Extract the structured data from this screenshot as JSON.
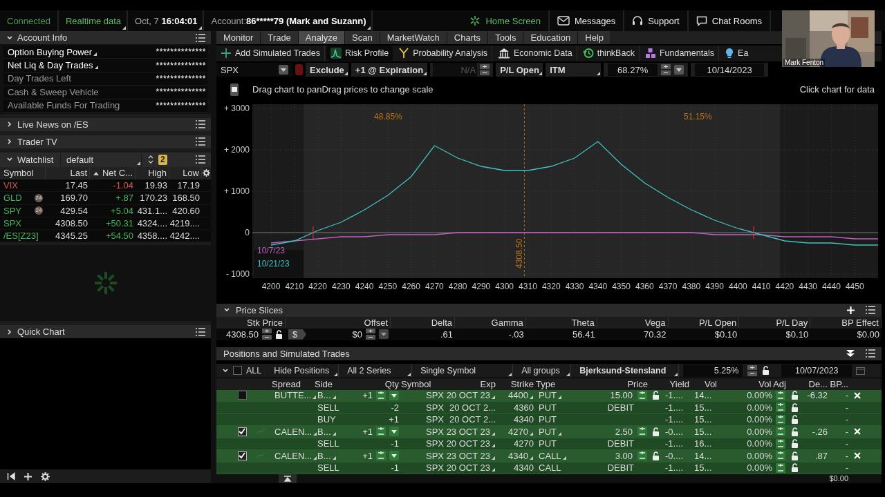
{
  "status_bar": {
    "connection": "Connected",
    "data_feed": "Realtime data",
    "date": "Oct, 7",
    "time": "16:04:01",
    "account_label": "Account:",
    "account": "86*****79 (Mark and Suzann)"
  },
  "top_links": [
    {
      "label": "Home Screen",
      "kind": "home"
    },
    {
      "label": "Messages",
      "kind": "mail"
    },
    {
      "label": "Support",
      "kind": "support"
    },
    {
      "label": "Chat Rooms",
      "kind": "chat"
    }
  ],
  "webcam": {
    "label": "Mark Fenton"
  },
  "account_info": {
    "title": "Account Info",
    "expanded": true,
    "rows": [
      {
        "label": "Option Buying Power",
        "value": "**************",
        "kind": "menu"
      },
      {
        "label": "Net Liq & Day Trades",
        "value": "**************",
        "kind": "menu"
      },
      {
        "label": "Day Trades Left",
        "value": "**************",
        "kind": "plain"
      },
      {
        "label": "Cash & Sweep Vehicle",
        "value": "**************",
        "kind": "plain"
      },
      {
        "label": "Available Funds For Trading",
        "value": "**************",
        "kind": "plain"
      }
    ]
  },
  "collapsed_panels": [
    {
      "title": "Live News on /ES",
      "expanded": false
    },
    {
      "title": "Trader TV",
      "expanded": false
    }
  ],
  "watchlist": {
    "title": "Watchlist",
    "expanded": true,
    "list": "default",
    "badge": "2",
    "columns": [
      "Symbol",
      "Last",
      "Net C...",
      "High",
      "Low"
    ],
    "rows": [
      {
        "symbol": "VIX",
        "last": "17.45",
        "change": "-1.04",
        "high": "19.93",
        "low": "17.19",
        "color": "#d9574c"
      },
      {
        "symbol": "GLD",
        "badge": "24",
        "last": "169.70",
        "change": "+.87",
        "high": "170.23",
        "low": "168.50",
        "color": "#45b65c"
      },
      {
        "symbol": "SPY",
        "badge": "24",
        "last": "429.54",
        "change": "+5.04",
        "high": "431.1...",
        "low": "420.60",
        "color": "#45b65c"
      },
      {
        "symbol": "SPX",
        "last": "4308.50",
        "change": "+50.31",
        "high": "4324....",
        "low": "4219....",
        "color": "#45b65c"
      },
      {
        "symbol": "/ES[Z23]",
        "last": "4345.25",
        "change": "+54.50",
        "high": "4358....",
        "low": "4242....",
        "color": "#45b65c"
      }
    ]
  },
  "quick_chart": {
    "title": "Quick Chart",
    "expanded": false
  },
  "nav_tabs": [
    {
      "label": "Monitor",
      "selected": false
    },
    {
      "label": "Trade",
      "selected": false
    },
    {
      "label": "Analyze",
      "selected": true
    },
    {
      "label": "Scan",
      "selected": false
    },
    {
      "label": "MarketWatch",
      "selected": false
    },
    {
      "label": "Charts",
      "selected": false
    },
    {
      "label": "Tools",
      "selected": false
    },
    {
      "label": "Education",
      "selected": false
    },
    {
      "label": "Help",
      "selected": false
    }
  ],
  "tools": [
    {
      "label": "Add Simulated Trades",
      "kind": "add",
      "selected": false
    },
    {
      "label": "Risk Profile",
      "kind": "risk",
      "selected": true
    },
    {
      "label": "Probability Analysis",
      "kind": "prob",
      "selected": false
    },
    {
      "label": "Economic Data",
      "kind": "econ",
      "selected": false
    },
    {
      "label": "thinkBack",
      "kind": "back",
      "selected": false
    },
    {
      "label": "Fundamentals",
      "kind": "fund",
      "selected": false
    },
    {
      "label": "Ea",
      "kind": "bulb",
      "selected": false
    }
  ],
  "controls": {
    "symbol": "SPX",
    "exclude": "Exclude",
    "series": "+1 @ Expiration",
    "offset_placeholder": "N/A",
    "pl_mode": "P/L Open",
    "itm": "ITM",
    "probability": "68.27%",
    "date": "10/14/2023"
  },
  "chart": {
    "hint": "Drag chart to panDrag prices to change scale",
    "click_hint": "Click chart for data",
    "chart_data": {
      "type": "line",
      "x": [
        4200,
        4210,
        4220,
        4230,
        4240,
        4250,
        4260,
        4270,
        4280,
        4290,
        4300,
        4310,
        4320,
        4330,
        4340,
        4350,
        4360,
        4370,
        4380,
        4390,
        4400,
        4410,
        4420,
        4430,
        4440,
        4450,
        4460
      ],
      "series": [
        {
          "name": "10/7/23",
          "color": "#c060c0",
          "values": [
            -250,
            -200,
            -150,
            -100,
            -100,
            -50,
            -50,
            -50,
            0,
            0,
            0,
            0,
            0,
            0,
            0,
            0,
            0,
            0,
            0,
            -50,
            -50,
            -50,
            -100,
            -100,
            -100,
            -150,
            -150
          ]
        },
        {
          "name": "10/21/23",
          "color": "#3fc4c4",
          "values": [
            -300,
            -200,
            50,
            250,
            550,
            900,
            1350,
            2100,
            1800,
            1600,
            1500,
            1500,
            1600,
            1800,
            2200,
            1650,
            1200,
            850,
            550,
            300,
            100,
            -50,
            -200,
            -250,
            -250,
            -300,
            -300
          ]
        }
      ],
      "grid": true,
      "xlim": [
        4192,
        4460
      ],
      "ylim": [
        -1000,
        3000
      ],
      "xticks": [
        4200,
        4210,
        4220,
        4230,
        4240,
        4250,
        4260,
        4270,
        4280,
        4290,
        4300,
        4310,
        4320,
        4330,
        4340,
        4350,
        4360,
        4370,
        4380,
        4390,
        4400,
        4410,
        4420,
        4430,
        4440,
        4450
      ],
      "yticks": [
        {
          "value": 3000,
          "label": "+ 3000"
        },
        {
          "value": 2000,
          "label": "+ 2000"
        },
        {
          "value": 1000,
          "label": "+ 1000"
        },
        {
          "value": 0,
          "label": "0"
        },
        {
          "value": -1000,
          "label": "- 1000"
        }
      ],
      "bands": [
        {
          "axis": "x",
          "from": 4214,
          "to": 4418
        }
      ],
      "ref_lines": [
        {
          "axis": "x",
          "value": 4308.5,
          "label": "4308.50"
        }
      ],
      "annotations": [
        "48.85%",
        "51.15%"
      ]
    }
  },
  "price_slices": {
    "title": "Price Slices",
    "expanded": true,
    "columns": [
      "Stk Price",
      "Offset",
      "Delta",
      "Gamma",
      "Theta",
      "Vega",
      "P/L Open",
      "P/L Day",
      "BP Effect"
    ],
    "offset_unit": "$",
    "values": [
      "4308.50",
      "$0",
      ".61",
      "-.03",
      "56.41",
      "70.32",
      "$0.10",
      "$0.10",
      "$0.00"
    ]
  },
  "positions": {
    "title": "Positions and Simulated Trades",
    "expanded": true,
    "filter": {
      "all_checked": false,
      "all": "ALL",
      "hide": "Hide Positions",
      "series": "All 2 Series",
      "symbol_mode": "Single Symbol",
      "groups": "All groups",
      "model": "Bjerksund-Stensland",
      "rate": "5.25%",
      "date": "10/07/2023"
    },
    "columns": [
      "Spread",
      "Side",
      "Qty",
      "Symbol",
      "Exp",
      "Strike",
      "Type",
      "Price",
      "Yield",
      "Vol",
      "Vol Adj",
      "De...",
      "BP..."
    ],
    "strategies": [
      {
        "checked": false,
        "spread": "BUTTE...",
        "delta": "-6.32",
        "legs": [
          {
            "side": "B...",
            "qty": "+1",
            "symbol": "SPX",
            "exp": "20 OCT 23",
            "strike": "4400",
            "type": "PUT",
            "price": "15.00",
            "yield": "-1....",
            "vol": "14...",
            "vol_adj": "0.00%",
            "bp": "-"
          },
          {
            "side": "SELL",
            "qty": "-2",
            "symbol": "SPX",
            "exp": "20 OCT 2...",
            "strike": "4360",
            "type": "PUT",
            "price": "DEBIT",
            "yield": "-1....",
            "vol": "15...",
            "vol_adj": "0.00%",
            "bp": "-"
          },
          {
            "side": "BUY",
            "qty": "+1",
            "symbol": "SPX",
            "exp": "20 OCT 2...",
            "strike": "4340",
            "type": "PUT",
            "yield": "-1....",
            "vol": "15...",
            "vol_adj": "0.00%",
            "bp": "-"
          }
        ]
      },
      {
        "checked": true,
        "spread": "CALEN...",
        "delta": "-.26",
        "legs": [
          {
            "side": "B...",
            "qty": "+1",
            "symbol": "SPX",
            "exp": "23 OCT 23",
            "strike": "4270",
            "type": "PUT",
            "price": "2.50",
            "yield": "-0....",
            "vol": "15...",
            "vol_adj": "0.00%",
            "bp": "-"
          },
          {
            "side": "SELL",
            "qty": "-1",
            "symbol": "SPX",
            "exp": "20 OCT 23",
            "strike": "4270",
            "type": "PUT",
            "price": "DEBIT",
            "yield": "-1....",
            "vol": "16...",
            "vol_adj": "0.00%",
            "bp": "-"
          }
        ]
      },
      {
        "checked": true,
        "spread": "CALEN...",
        "delta": ".87",
        "legs": [
          {
            "side": "B...",
            "qty": "+1",
            "symbol": "SPX",
            "exp": "23 OCT 23",
            "strike": "4340",
            "type": "CALL",
            "price": "3.00",
            "yield": "-0....",
            "vol": "14...",
            "vol_adj": "0.00%",
            "bp": "-"
          },
          {
            "side": "SELL",
            "qty": "-1",
            "symbol": "SPX",
            "exp": "20 OCT 23",
            "strike": "4340",
            "type": "CALL",
            "price": "DEBIT",
            "yield": "-1....",
            "vol": "15...",
            "vol_adj": "0.00%",
            "bp": "-"
          }
        ]
      }
    ],
    "total_bp": "$0.00"
  }
}
